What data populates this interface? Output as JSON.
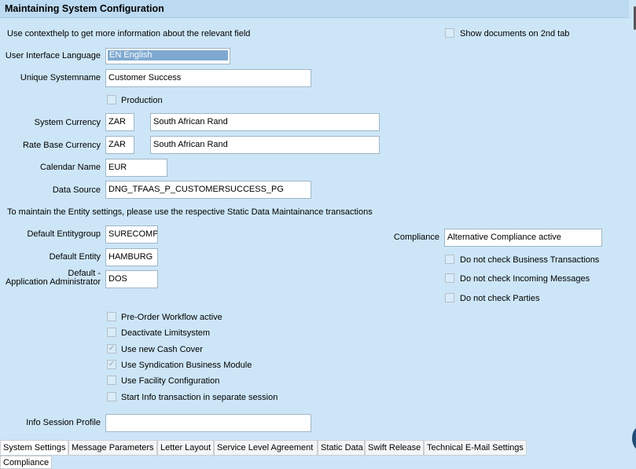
{
  "header": {
    "title": "Maintaining System Configuration"
  },
  "help_text": "Use contexthelp to get more information about the relevant field",
  "show_docs_label": "Show documents on 2nd tab",
  "ui_language": {
    "label": "User Interface Language",
    "value": "EN English"
  },
  "systemname": {
    "label": "Unique Systemname",
    "value": "Customer Success"
  },
  "production_label": "Production",
  "system_currency": {
    "label": "System Currency",
    "code": "ZAR",
    "name": "South African Rand"
  },
  "rate_base_currency": {
    "label": "Rate Base Currency",
    "code": "ZAR",
    "name": "South African Rand"
  },
  "calendar": {
    "label": "Calendar Name",
    "value": "EUR"
  },
  "data_source": {
    "label": "Data Source",
    "value": "DNG_TFAAS_P_CUSTOMERSUCCESS_PG"
  },
  "entity_note": "To maintain the Entity settings, please use the respective Static Data Maintainance transactions",
  "entitygroup": {
    "label": "Default Entitygroup",
    "value": "SURECOMP"
  },
  "entity": {
    "label": "Default Entity",
    "value": "HAMBURG"
  },
  "admin": {
    "label_line1": "Default -",
    "label_line2": "Application Administrator",
    "value": "DOS"
  },
  "compliance": {
    "label": "Compliance",
    "value": "Alternative Compliance active",
    "checks": [
      "Do not check Business Transactions",
      "Do not check Incoming Messages",
      "Do not check Parties"
    ]
  },
  "options": [
    {
      "label": "Pre-Order Workflow active",
      "checked": false
    },
    {
      "label": "Deactivate Limitsystem",
      "checked": false
    },
    {
      "label": "Use new Cash Cover",
      "checked": true
    },
    {
      "label": "Use Syndication Business Module",
      "checked": true
    },
    {
      "label": "Use Facility Configuration",
      "checked": false
    },
    {
      "label": "Start Info transaction in separate session",
      "checked": false
    }
  ],
  "info_session": {
    "label": "Info Session Profile",
    "value": ""
  },
  "tabs": [
    "System Settings",
    "Message Parameters",
    "Letter Layout",
    "Service Level Agreement",
    "Static Data",
    "Swift Release",
    "Technical E-Mail Settings",
    "Compliance"
  ],
  "colors": {
    "background": "#cde6f7",
    "header": "#bcdaf1",
    "selection": "#7fa9d1"
  }
}
